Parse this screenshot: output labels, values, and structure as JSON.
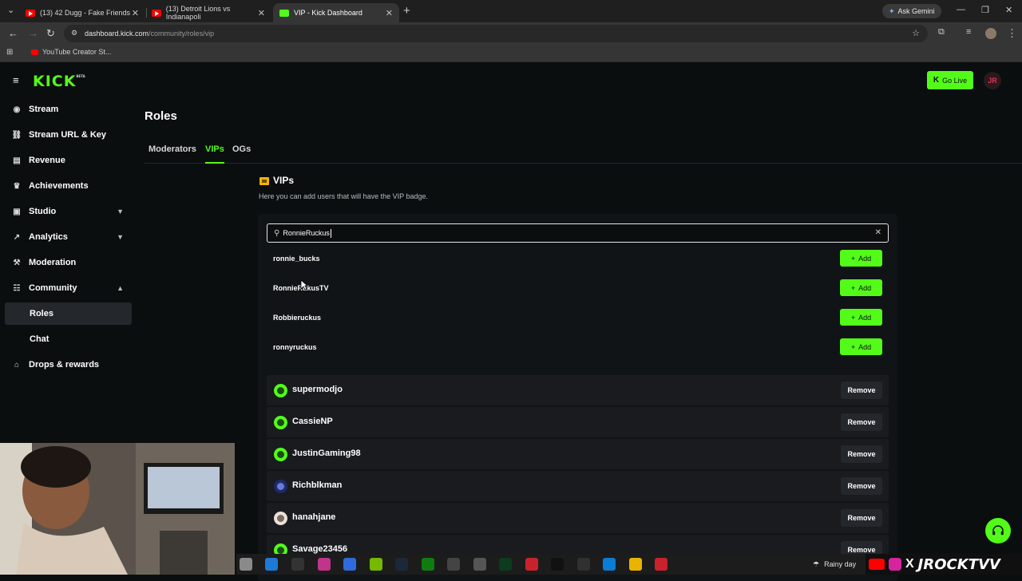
{
  "browser": {
    "tabs": [
      {
        "title": "(13) 42 Dugg - Fake Friends",
        "active": false
      },
      {
        "title": "(13) Detroit Lions vs Indianapoli",
        "active": false
      },
      {
        "title": "VIP - Kick Dashboard",
        "active": true
      }
    ],
    "ask_gemini": "Ask Gemini",
    "url_host": "dashboard.kick.com",
    "url_path": "/community/roles/vip",
    "bookmark": "YouTube Creator St..."
  },
  "header": {
    "logo": "KICK",
    "logo_badge": "BETA",
    "go_live": "Go Live",
    "avatar_initials": "JR"
  },
  "sidebar": {
    "items": [
      {
        "label": "Stream",
        "icon": "stream-icon"
      },
      {
        "label": "Stream URL & Key",
        "icon": "link-icon"
      },
      {
        "label": "Revenue",
        "icon": "revenue-icon"
      },
      {
        "label": "Achievements",
        "icon": "trophy-icon"
      },
      {
        "label": "Studio",
        "icon": "studio-icon",
        "expandable": true
      },
      {
        "label": "Analytics",
        "icon": "analytics-icon",
        "expandable": true
      },
      {
        "label": "Moderation",
        "icon": "hammer-icon"
      },
      {
        "label": "Community",
        "icon": "community-icon",
        "expandable": true,
        "expanded": true
      },
      {
        "label": "Roles",
        "sub": true,
        "active": true
      },
      {
        "label": "Chat",
        "sub": true
      },
      {
        "label": "Drops & rewards",
        "icon": "gift-icon"
      }
    ]
  },
  "main": {
    "title": "Roles",
    "tabs": [
      {
        "label": "Moderators",
        "active": false
      },
      {
        "label": "VIPs",
        "active": true
      },
      {
        "label": "OGs",
        "active": false
      }
    ],
    "section_title": "VIPs",
    "section_desc": "Here you can add users that will have the VIP badge.",
    "search_value": "RonnieRuckus",
    "add_label": "Add",
    "remove_label": "Remove",
    "search_results": [
      "ronnie_bucks",
      "RonnieRukusTV",
      "Robbieruckus",
      "ronnyruckus"
    ],
    "vips": [
      "supermodjo",
      "CassieNP",
      "JustinGaming98",
      "Richblkman",
      "hanahjane",
      "Savage23456"
    ]
  },
  "taskbar": {
    "weather": "Rainy day",
    "brand": "JROCKTVV"
  },
  "colors": {
    "accent": "#53fc18",
    "background": "#0b0e0f",
    "panel": "#111416",
    "row": "#191b1f"
  }
}
